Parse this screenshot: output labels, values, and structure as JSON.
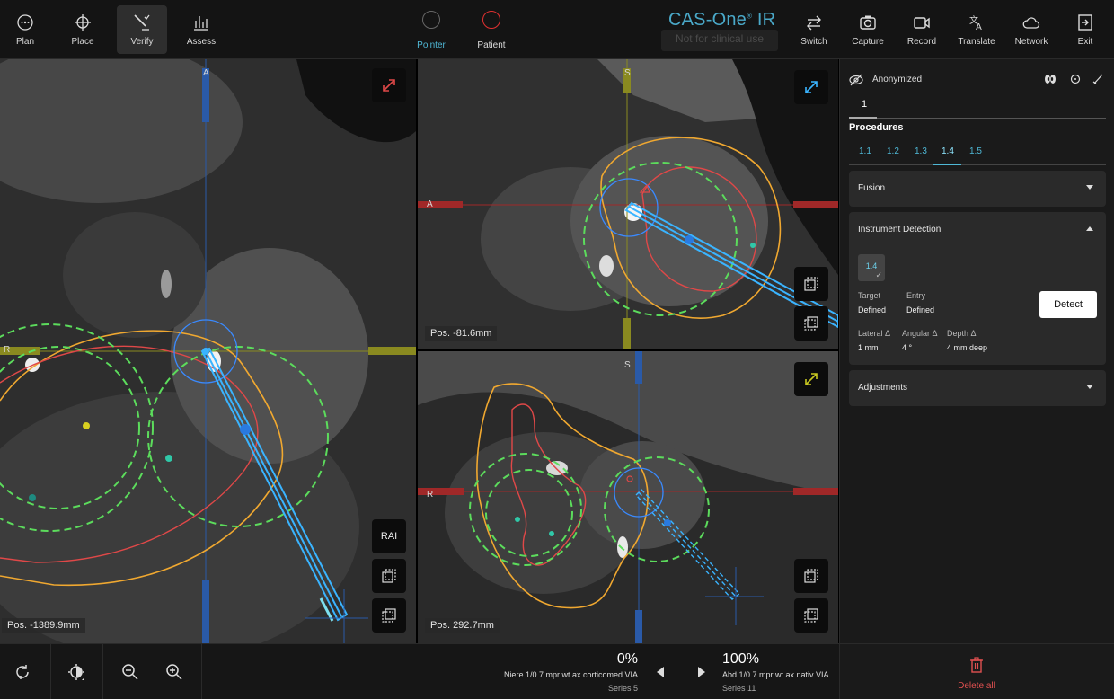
{
  "toolbar": {
    "left": [
      {
        "label": "Plan",
        "icon": "plan-icon"
      },
      {
        "label": "Place",
        "icon": "crosshair-icon"
      },
      {
        "label": "Verify",
        "icon": "verify-icon",
        "active": true
      },
      {
        "label": "Assess",
        "icon": "bar-chart-icon"
      }
    ],
    "pointer": {
      "label": "Pointer",
      "color": "#555555"
    },
    "patient": {
      "label": "Patient",
      "color": "#e03030"
    },
    "brand": "CAS-One",
    "brand_suffix": "IR",
    "not_clinical": "Not for clinical use",
    "right": [
      {
        "label": "Switch",
        "icon": "switch-icon"
      },
      {
        "label": "Capture",
        "icon": "camera-icon"
      },
      {
        "label": "Record",
        "icon": "video-icon"
      },
      {
        "label": "Translate",
        "icon": "translate-icon"
      },
      {
        "label": "Network",
        "icon": "cloud-icon"
      },
      {
        "label": "Exit",
        "icon": "exit-icon"
      }
    ]
  },
  "viewports": {
    "left": {
      "pos": "Pos. -1389.9mm",
      "axis_top": "A",
      "axis_left": "R",
      "orientation": "RAI"
    },
    "top_right": {
      "pos": "Pos. -81.6mm",
      "axis_top": "S",
      "axis_left": "A"
    },
    "bottom_right": {
      "pos": "Pos. 292.7mm",
      "axis_top": "S",
      "axis_left": "R"
    }
  },
  "panel": {
    "anonymized": "Anonymized",
    "tab": "1",
    "procedures_title": "Procedures",
    "procedures": [
      "1.1",
      "1.2",
      "1.3",
      "1.4",
      "1.5"
    ],
    "selected_procedure": "1.4",
    "fusion": "Fusion",
    "instrument_detection": "Instrument Detection",
    "chip": "1.4",
    "target_label": "Target",
    "target_value": "Defined",
    "entry_label": "Entry",
    "entry_value": "Defined",
    "detect": "Detect",
    "lateral_label": "Lateral Δ",
    "lateral_value": "1 mm",
    "angular_label": "Angular Δ",
    "angular_value": "4 °",
    "depth_label": "Depth Δ",
    "depth_value": "4 mm deep",
    "adjustments": "Adjustments"
  },
  "bottom": {
    "series_left": {
      "pct": "0%",
      "name": "Niere 1/0.7 mpr wt ax corticomed VIA",
      "series": "Series 5"
    },
    "series_right": {
      "pct": "100%",
      "name": "Abd 1/0.7 mpr wt ax nativ VIA",
      "series": "Series 11"
    },
    "delete_all": "Delete all"
  },
  "colors": {
    "accent": "#4fb8d6",
    "danger": "#e05050",
    "needle": "#3ab4ff",
    "ablation": "#5cdc5c",
    "organ": "#f0a830",
    "tumor": "#e04848"
  }
}
